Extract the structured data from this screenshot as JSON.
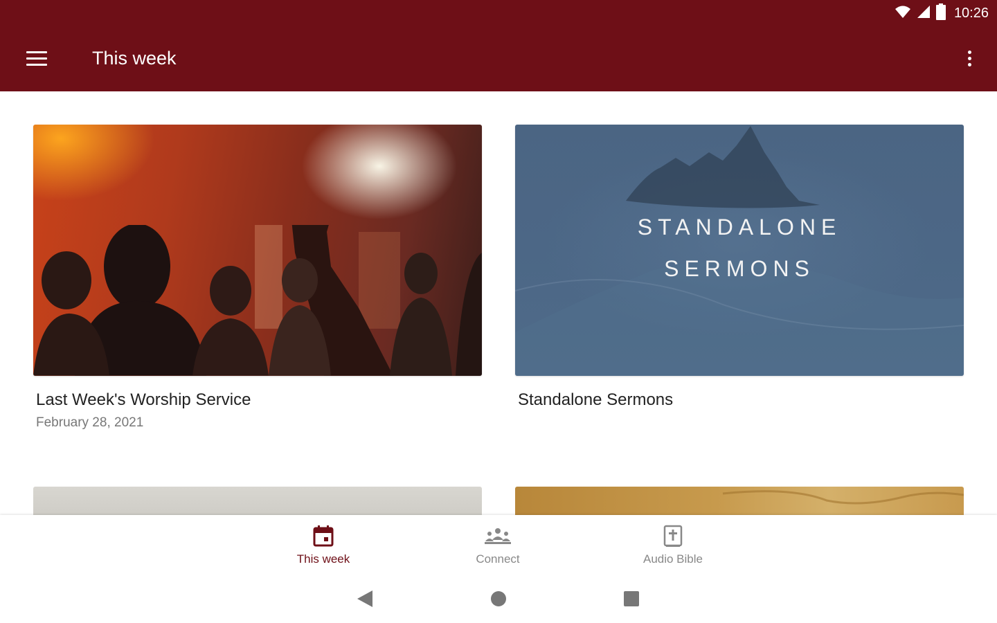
{
  "status_bar": {
    "time": "10:26",
    "icons": [
      "wifi-icon",
      "signal-icon",
      "battery-icon"
    ]
  },
  "app_bar": {
    "title": "This week",
    "menu_icon": "hamburger-menu-icon",
    "overflow_icon": "more-vert-icon",
    "color": "#6e0f17"
  },
  "cards": [
    {
      "title": "Last Week's Worship Service",
      "subtitle": "February 28, 2021",
      "image": "worship-concert-image"
    },
    {
      "title": "Standalone Sermons",
      "subtitle": "",
      "image": "ocean-rock-image",
      "image_text": [
        "STANDALONE",
        "SERMONS"
      ]
    }
  ],
  "bottom_nav": {
    "items": [
      {
        "label": "This week",
        "icon": "calendar-icon",
        "active": true
      },
      {
        "label": "Connect",
        "icon": "people-icon",
        "active": false
      },
      {
        "label": "Audio Bible",
        "icon": "bible-icon",
        "active": false
      }
    ],
    "active_color": "#6e0f17",
    "inactive_color": "#888888"
  },
  "system_nav": {
    "icons": [
      "back-icon",
      "home-icon",
      "recents-icon"
    ]
  }
}
